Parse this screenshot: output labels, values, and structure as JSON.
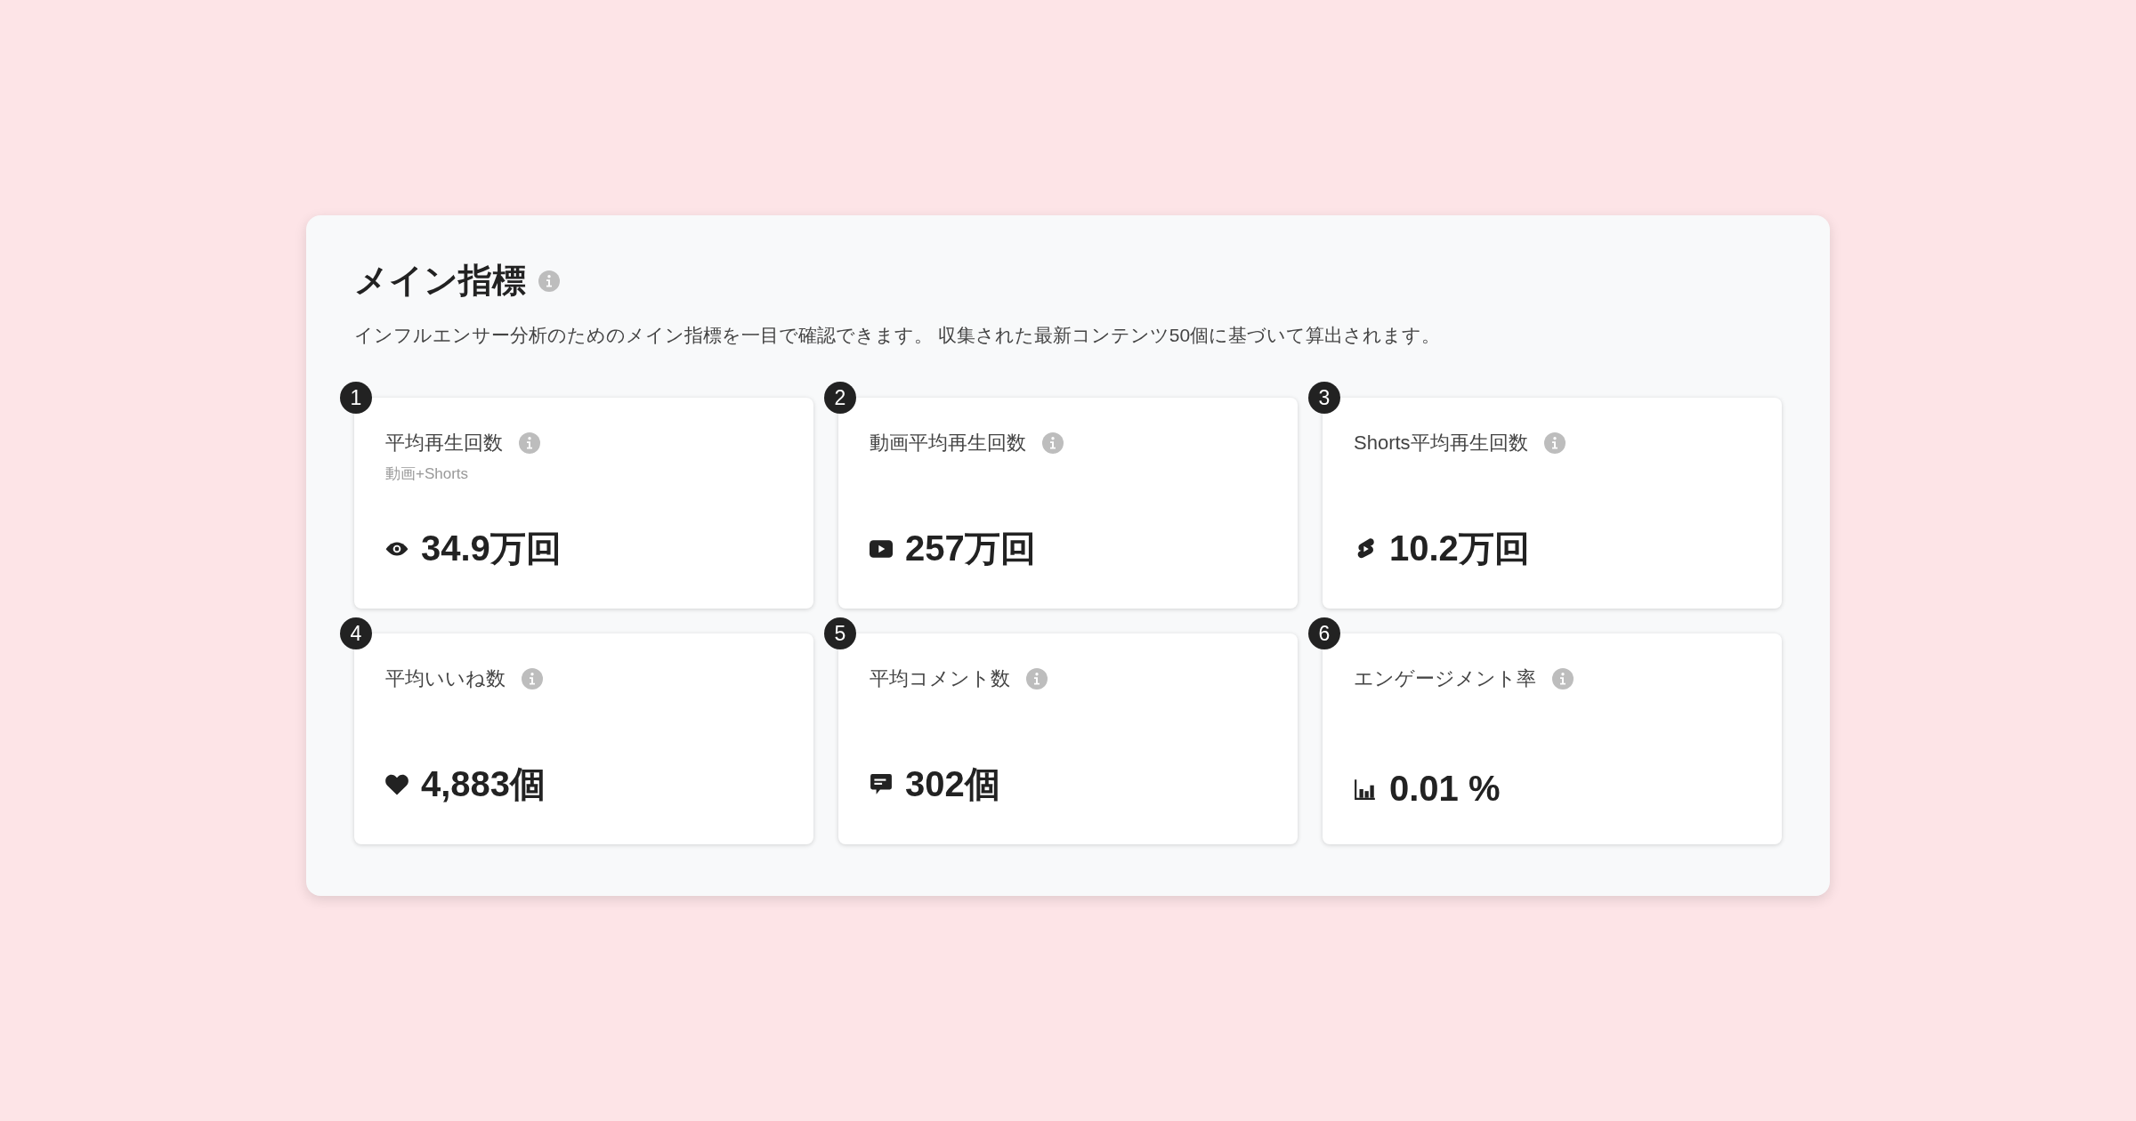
{
  "section": {
    "title": "メイン指標",
    "description": "インフルエンサー分析のためのメイン指標を一目で確認できます。 収集された最新コンテンツ50個に基づいて算出されます。"
  },
  "metrics": [
    {
      "badge": "1",
      "label": "平均再生回数",
      "sublabel": "動画+Shorts",
      "kind": "views",
      "value": "34.9万回"
    },
    {
      "badge": "2",
      "label": "動画平均再生回数",
      "kind": "video",
      "value": "257万回"
    },
    {
      "badge": "3",
      "label": "Shorts平均再生回数",
      "kind": "shorts",
      "value": "10.2万回"
    },
    {
      "badge": "4",
      "label": "平均いいね数",
      "kind": "likes",
      "value": "4,883個"
    },
    {
      "badge": "5",
      "label": "平均コメント数",
      "kind": "comments",
      "value": "302個"
    },
    {
      "badge": "6",
      "label": "エンゲージメント率",
      "kind": "engagement",
      "value": "0.01 %"
    }
  ]
}
